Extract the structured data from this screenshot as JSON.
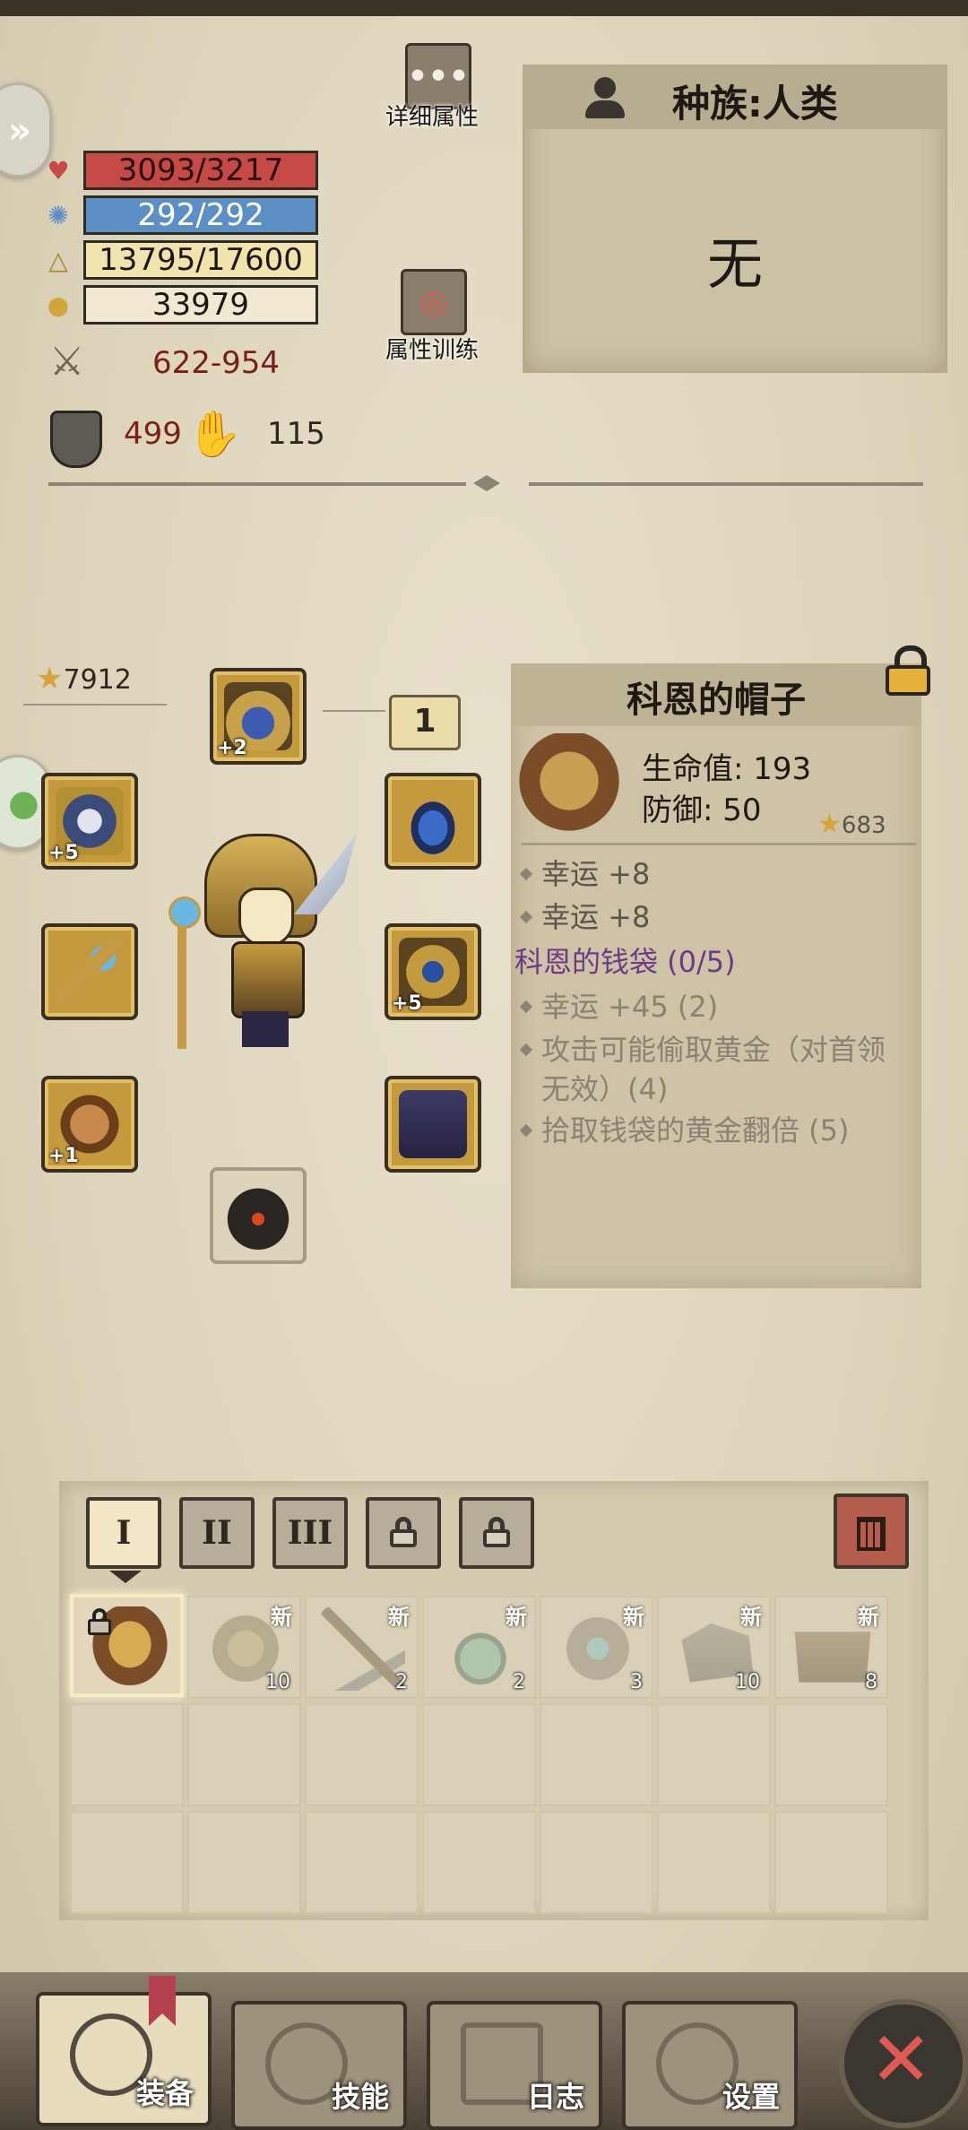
{
  "stats": {
    "hp": "3093/3217",
    "mp": "292/292",
    "xp": "13795/17600",
    "gold": "33979",
    "attack": "622-954",
    "defense": "499",
    "luck": "115"
  },
  "buttons": {
    "details": "详细属性",
    "training": "属性训练"
  },
  "race": {
    "title": "种族:人类",
    "value": "无"
  },
  "equipment": {
    "power": "7912",
    "ring_slot": "1",
    "slots": [
      {
        "name": "helm",
        "plus": "+2"
      },
      {
        "name": "shoulder",
        "plus": "+5"
      },
      {
        "name": "staff",
        "plus": ""
      },
      {
        "name": "glove",
        "plus": "+1"
      },
      {
        "name": "amulet",
        "plus": ""
      },
      {
        "name": "armor",
        "plus": "+5"
      },
      {
        "name": "pants",
        "plus": ""
      },
      {
        "name": "boots",
        "plus": ""
      }
    ]
  },
  "detail": {
    "title": "科恩的帽子",
    "hp": "生命值: 193",
    "def": "防御: 50",
    "score": "683",
    "affix1": "幸运 +8",
    "affix2": "幸运 +8",
    "set_name": "科恩的钱袋 (0/5)",
    "set_bonus1": "幸运 +45 (2)",
    "set_bonus2a": "攻击可能偷取黄金（对首领",
    "set_bonus2b": "无效）(4)",
    "set_bonus3": "拾取钱袋的黄金翻倍 (5)"
  },
  "inventory": {
    "tabs": [
      "I",
      "II",
      "III"
    ],
    "items": [
      {
        "icon": "hat-icon",
        "count": "",
        "new": ""
      },
      {
        "icon": "scroll-icon",
        "count": "10",
        "new": "新"
      },
      {
        "icon": "pickaxe-icon",
        "count": "2",
        "new": "新"
      },
      {
        "icon": "potion-icon",
        "count": "2",
        "new": "新"
      },
      {
        "icon": "ore-icon",
        "count": "3",
        "new": "新"
      },
      {
        "icon": "stone-icon",
        "count": "10",
        "new": "新"
      },
      {
        "icon": "chest-icon",
        "count": "8",
        "new": "新"
      }
    ]
  },
  "nav": {
    "equip": "装备",
    "skills": "技能",
    "log": "日志",
    "settings": "设置"
  }
}
